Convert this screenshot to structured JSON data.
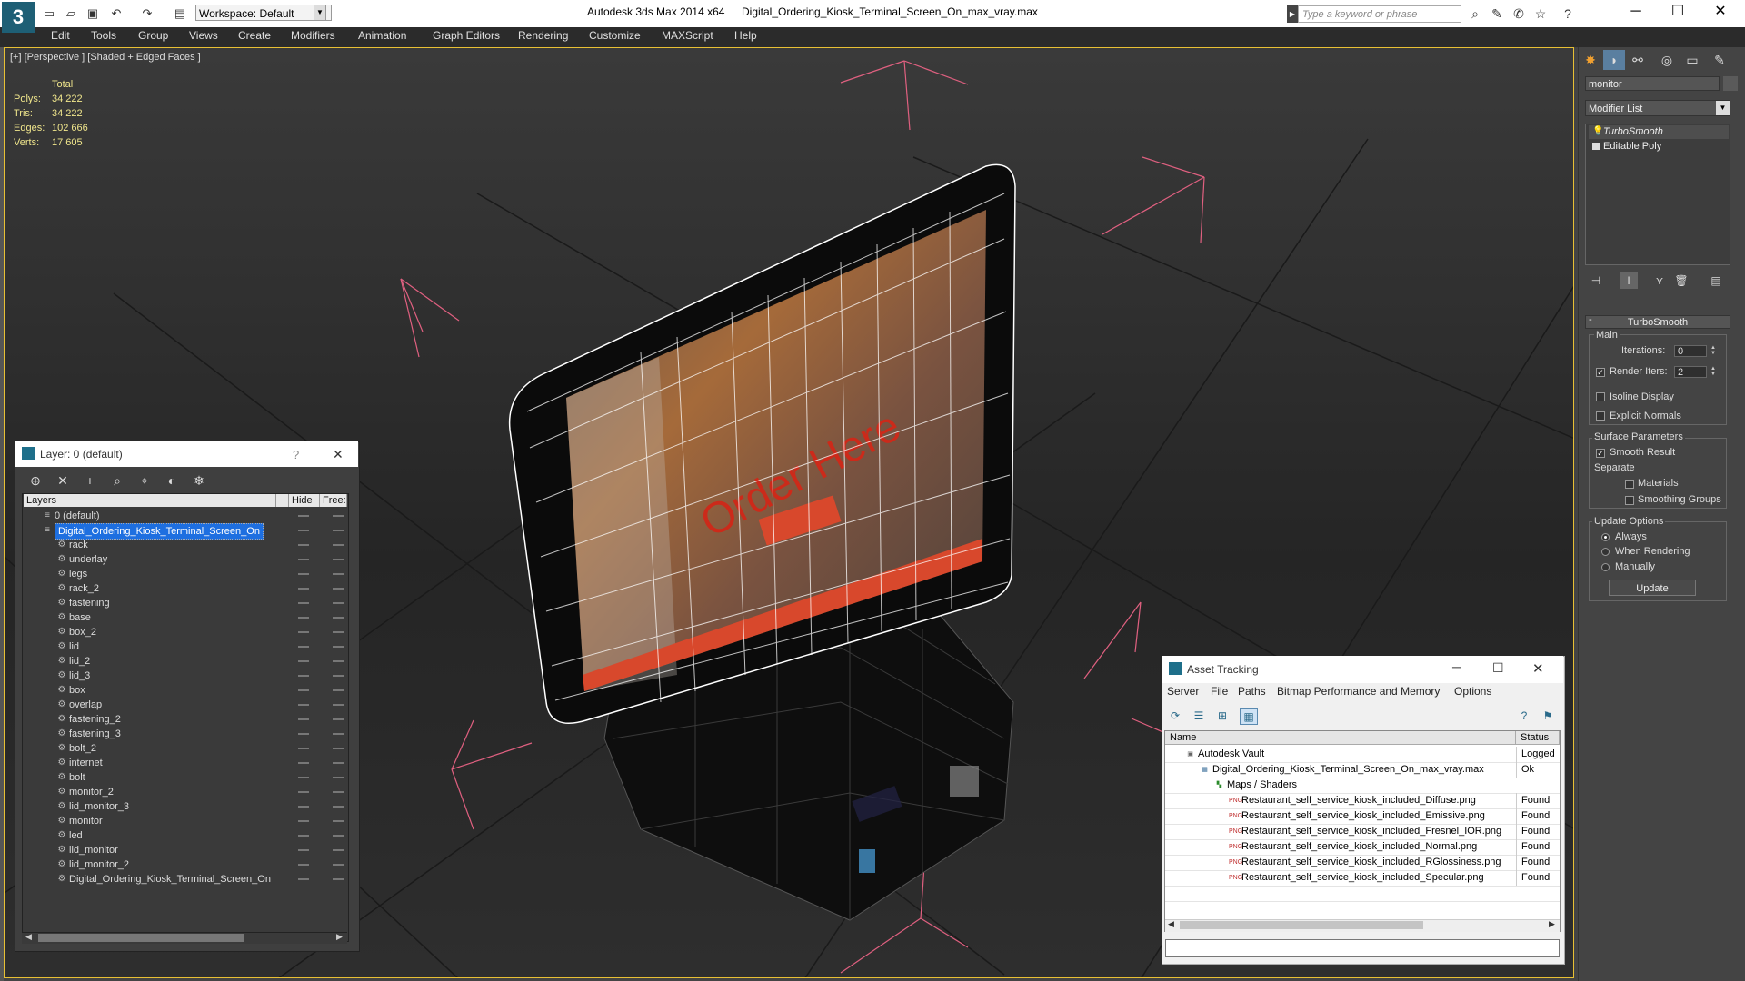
{
  "app": {
    "title": "Autodesk 3ds Max  2014 x64",
    "file": "Digital_Ordering_Kiosk_Terminal_Screen_On_max_vray.max",
    "logo": "3",
    "workspace": "Workspace: Default",
    "search_placeholder": "Type a keyword or phrase"
  },
  "menu": [
    "Edit",
    "Tools",
    "Group",
    "Views",
    "Create",
    "Modifiers",
    "Animation",
    "Graph Editors",
    "Rendering",
    "Customize",
    "MAXScript",
    "Help"
  ],
  "viewport": {
    "label": "[+] [Perspective ] [Shaded + Edged Faces ]",
    "stats_header": "Total",
    "stats": [
      {
        "label": "Polys:",
        "value": "34 222"
      },
      {
        "label": "Tris:",
        "value": "34 222"
      },
      {
        "label": "Edges:",
        "value": "102 666"
      },
      {
        "label": "Verts:",
        "value": "17 605"
      }
    ],
    "screen_text": "Order Here"
  },
  "command_panel": {
    "object_name": "monitor",
    "modifier_list": "Modifier List",
    "stack": [
      "TurboSmooth",
      "Editable Poly"
    ],
    "turbosmooth": {
      "title": "TurboSmooth",
      "main": "Main",
      "iterations_label": "Iterations:",
      "iterations": "0",
      "render_iters_label": "Render Iters:",
      "render_iters": "2",
      "isoline": "Isoline Display",
      "explicit_normals": "Explicit Normals",
      "surface_params": "Surface Parameters",
      "smooth_result": "Smooth Result",
      "separate": "Separate",
      "materials": "Materials",
      "smoothing_groups": "Smoothing Groups",
      "update_options": "Update Options",
      "always": "Always",
      "when_rendering": "When Rendering",
      "manually": "Manually",
      "update_button": "Update"
    }
  },
  "layer_panel": {
    "title": "Layer: 0 (default)",
    "help": "?",
    "close": "✕",
    "col_layers": "Layers",
    "col_hide": "Hide",
    "col_freeze": "Free:",
    "layers": [
      "0 (default)",
      "Digital_Ordering_Kiosk_Terminal_Screen_On"
    ],
    "objects": [
      "rack",
      "underlay",
      "legs",
      "rack_2",
      "fastening",
      "base",
      "box_2",
      "lid",
      "lid_2",
      "lid_3",
      "box",
      "overlap",
      "fastening_2",
      "fastening_3",
      "bolt_2",
      "internet",
      "bolt",
      "monitor_2",
      "lid_monitor_3",
      "monitor",
      "led",
      "lid_monitor",
      "lid_monitor_2",
      "Digital_Ordering_Kiosk_Terminal_Screen_On"
    ]
  },
  "asset_tracking": {
    "title": "Asset Tracking",
    "menu": [
      "Server",
      "File",
      "Paths",
      "Bitmap Performance and Memory",
      "Options"
    ],
    "col_name": "Name",
    "col_status": "Status",
    "rows": [
      {
        "name": "Autodesk Vault",
        "status": "Logged",
        "indent": 0,
        "icon": "vault"
      },
      {
        "name": "Digital_Ordering_Kiosk_Terminal_Screen_On_max_vray.max",
        "status": "Ok",
        "indent": 1,
        "icon": "max"
      },
      {
        "name": "Maps / Shaders",
        "status": "",
        "indent": 2,
        "icon": "maps"
      },
      {
        "name": "Restaurant_self_service_kiosk_included_Diffuse.png",
        "status": "Found",
        "indent": 3,
        "icon": "png"
      },
      {
        "name": "Restaurant_self_service_kiosk_included_Emissive.png",
        "status": "Found",
        "indent": 3,
        "icon": "png"
      },
      {
        "name": "Restaurant_self_service_kiosk_included_Fresnel_IOR.png",
        "status": "Found",
        "indent": 3,
        "icon": "png"
      },
      {
        "name": "Restaurant_self_service_kiosk_included_Normal.png",
        "status": "Found",
        "indent": 3,
        "icon": "png"
      },
      {
        "name": "Restaurant_self_service_kiosk_included_RGlossiness.png",
        "status": "Found",
        "indent": 3,
        "icon": "png"
      },
      {
        "name": "Restaurant_self_service_kiosk_included_Specular.png",
        "status": "Found",
        "indent": 3,
        "icon": "png"
      }
    ]
  },
  "colors": {
    "viewport_border": "#e8c034",
    "selection": "#1e6fe0",
    "stats_text": "#f0e68c",
    "bbox_lines": "#e06080"
  }
}
